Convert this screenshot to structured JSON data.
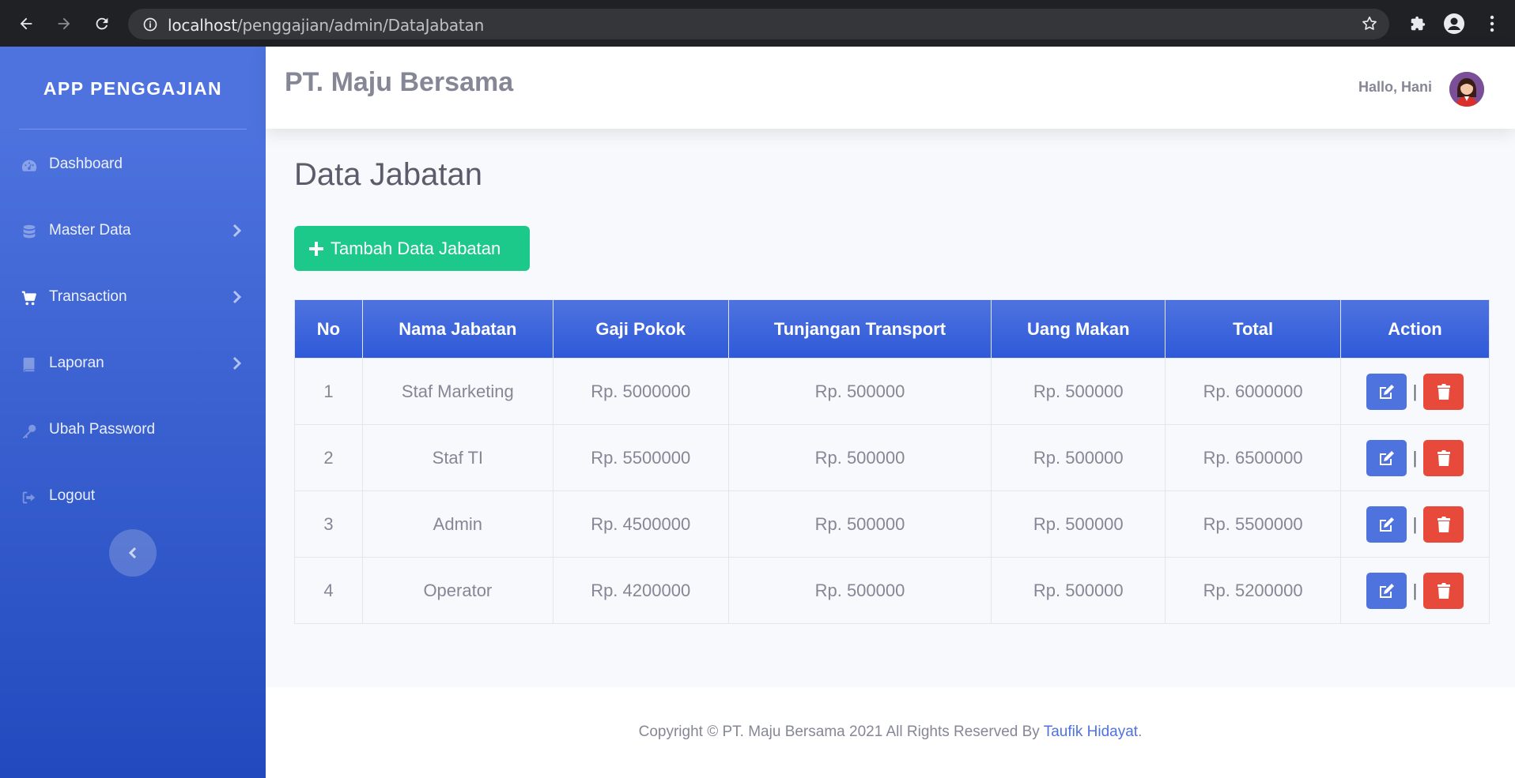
{
  "browser": {
    "url_host": "localhost",
    "url_path": "/penggajian/admin/DataJabatan"
  },
  "sidebar": {
    "brand": "APP PENGGAJIAN",
    "items": [
      {
        "label": "Dashboard",
        "icon": "tachometer-icon"
      },
      {
        "label": "Master Data",
        "icon": "database-icon"
      },
      {
        "label": "Transaction",
        "icon": "shopping-cart-icon"
      },
      {
        "label": "Laporan",
        "icon": "book-icon"
      },
      {
        "label": "Ubah Password",
        "icon": "key-icon"
      },
      {
        "label": "Logout",
        "icon": "sign-out-icon"
      }
    ]
  },
  "topbar": {
    "company": "PT. Maju Bersama",
    "greeting": "Hallo, Hani"
  },
  "main": {
    "title": "Data Jabatan",
    "add_button": "Tambah Data Jabatan",
    "table": {
      "headers": [
        "No",
        "Nama Jabatan",
        "Gaji Pokok",
        "Tunjangan Transport",
        "Uang Makan",
        "Total",
        "Action"
      ],
      "rows": [
        [
          "1",
          "Staf Marketing",
          "Rp. 5000000",
          "Rp. 500000",
          "Rp. 500000",
          "Rp. 6000000"
        ],
        [
          "2",
          "Staf TI",
          "Rp. 5500000",
          "Rp. 500000",
          "Rp. 500000",
          "Rp. 6500000"
        ],
        [
          "3",
          "Admin",
          "Rp. 4500000",
          "Rp. 500000",
          "Rp. 500000",
          "Rp. 5500000"
        ],
        [
          "4",
          "Operator",
          "Rp. 4200000",
          "Rp. 500000",
          "Rp. 500000",
          "Rp. 5200000"
        ]
      ],
      "action_separator": "|"
    }
  },
  "footer": {
    "text": "Copyright © PT. Maju Bersama 2021 All Rights Reserved By ",
    "author": "Taufik Hidayat",
    "suffix": "."
  },
  "colors": {
    "primary": "#4e73df",
    "success": "#1cc88a",
    "danger": "#e74a3b"
  }
}
